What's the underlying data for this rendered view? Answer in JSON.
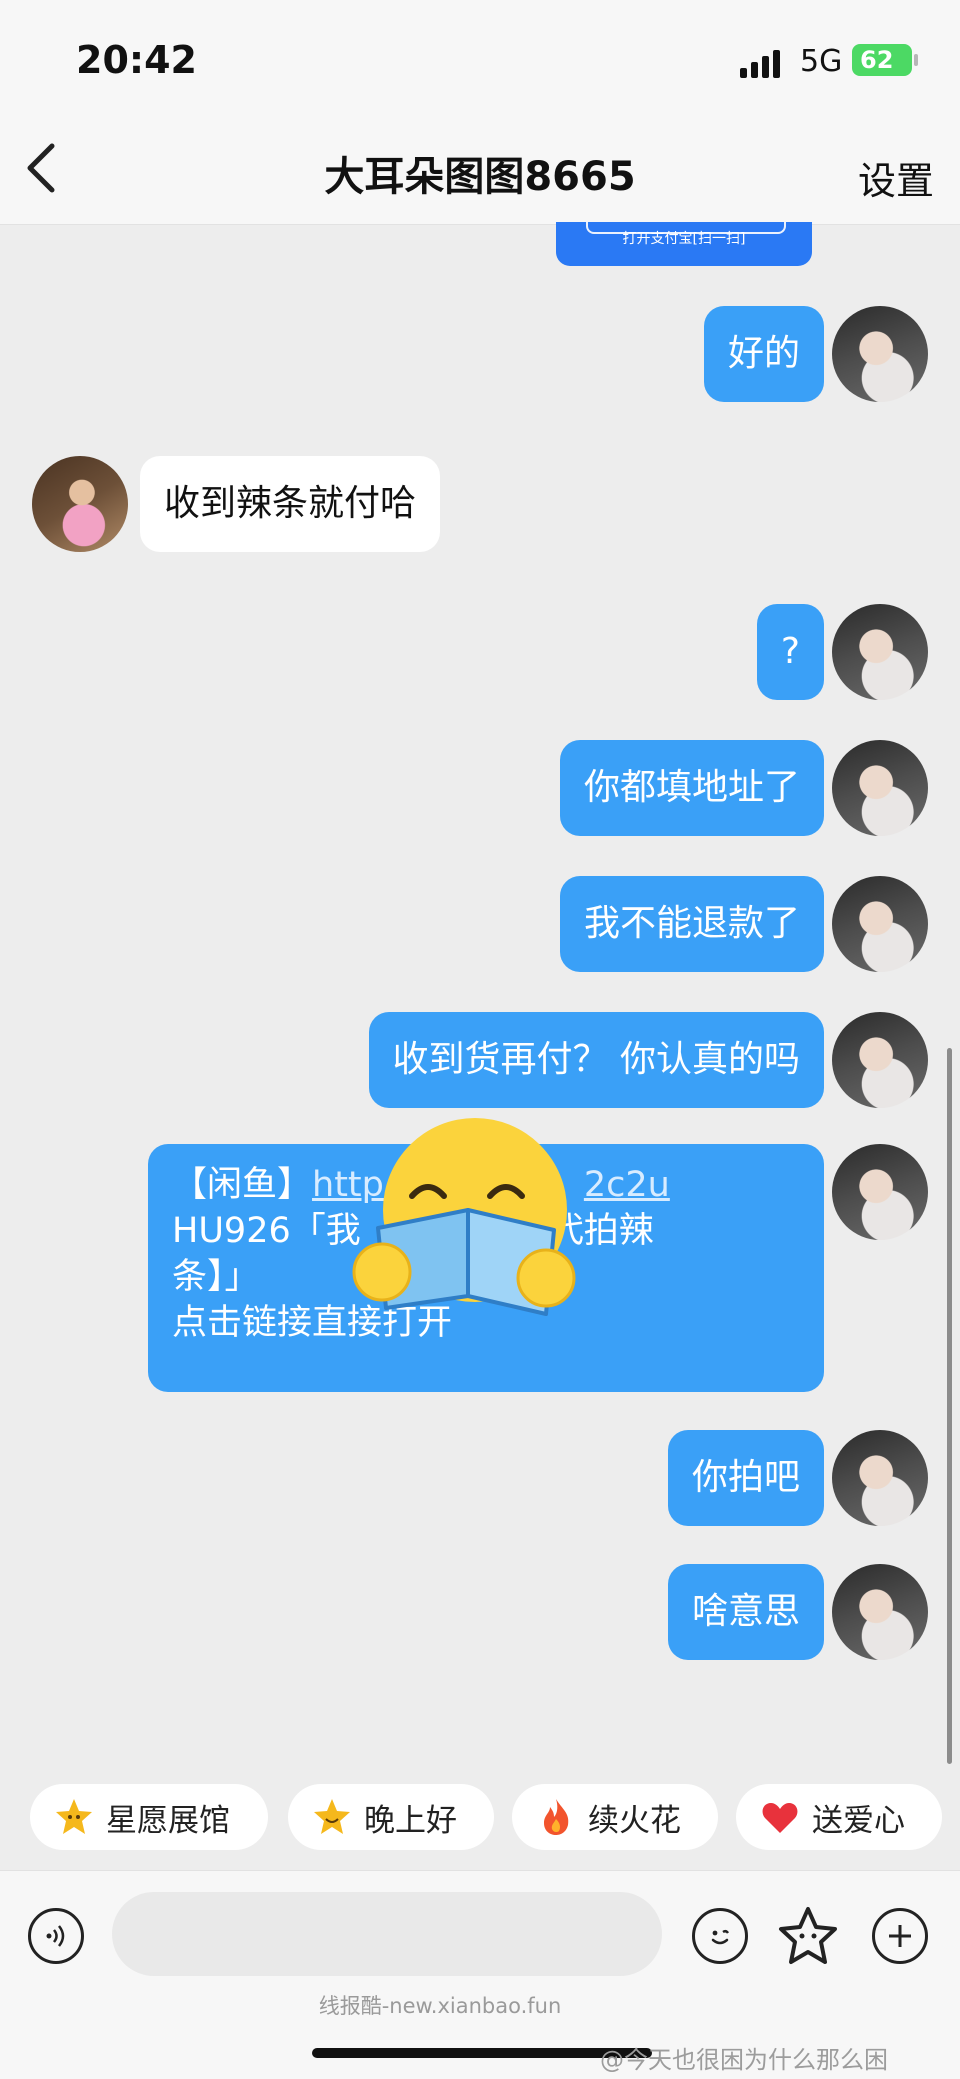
{
  "status_bar": {
    "time": "20:42",
    "network": "5G",
    "battery": "62"
  },
  "header": {
    "title": "大耳朵图图8665",
    "settings_label": "设置"
  },
  "messages": [
    {
      "text": "好的"
    },
    {
      "text": "收到辣条就付哈"
    },
    {
      "text": "?"
    },
    {
      "text": "你都填地址了"
    },
    {
      "text": "我不能退款了"
    },
    {
      "text": "收到货再付？  你认真的吗"
    },
    {
      "prefix": "【闲鱼】",
      "link": "http",
      "link_tail": "2c2u",
      "line2a": "HU926「我",
      "line2b": "了【代拍辣",
      "line3": "条】」",
      "line4": "点击链接直接打开"
    },
    {
      "text": "你拍吧"
    },
    {
      "text": "啥意思"
    }
  ],
  "peek_text": "打开支付宝[扫一扫]",
  "quick_replies": [
    {
      "label": "星愿展馆",
      "icon": "star-face-icon",
      "color": "#f5b81c"
    },
    {
      "label": "晚上好",
      "icon": "star-smile-icon",
      "color": "#f5b81c"
    },
    {
      "label": "续火花",
      "icon": "fire-icon",
      "color": "#f2542d"
    },
    {
      "label": "送爱心",
      "icon": "heart-icon",
      "color": "#e8323c"
    }
  ],
  "input": {
    "placeholder": ""
  },
  "watermarks": {
    "site": "线报酷-new.xianbao.fun",
    "weibo": "@今天也很困为什么那么困"
  },
  "colors": {
    "outgoing_bubble": "#3aa0f7",
    "incoming_bubble": "#ffffff",
    "background": "#ededed"
  }
}
